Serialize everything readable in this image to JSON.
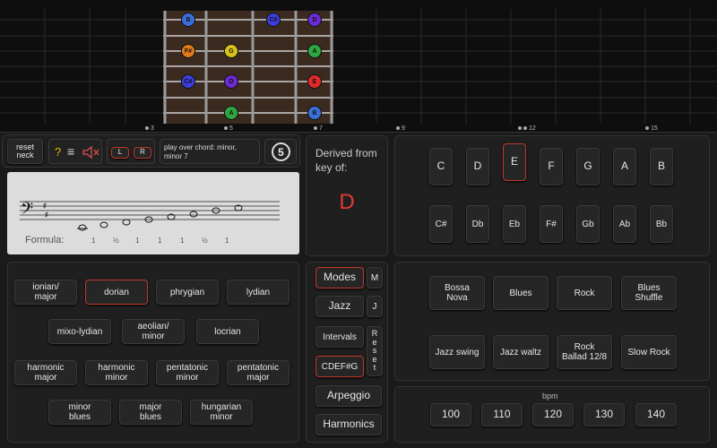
{
  "fretboard": {
    "fret_labels": [
      {
        "text": "3",
        "dots": 1
      },
      {
        "text": "5",
        "dots": 1
      },
      {
        "text": "7",
        "dots": 1
      },
      {
        "text": "9",
        "dots": 1
      },
      {
        "text": "12",
        "dots": 2
      },
      {
        "text": "15",
        "dots": 1
      }
    ],
    "notes": [
      {
        "label": "B",
        "color": "#3a6fd8"
      },
      {
        "label": "C#",
        "color": "#3d3ddb"
      },
      {
        "label": "D",
        "color": "#6a2bd0"
      },
      {
        "label": "F#",
        "color": "#e07b1a"
      },
      {
        "label": "G",
        "color": "#d8c21a"
      },
      {
        "label": "A",
        "color": "#2fa640"
      },
      {
        "label": "C#",
        "color": "#3d3ddb"
      },
      {
        "label": "D",
        "color": "#6a2bd0"
      },
      {
        "label": "E",
        "color": "#e02a2a"
      },
      {
        "label": "A",
        "color": "#2fa640"
      },
      {
        "label": "B",
        "color": "#3a6fd8"
      }
    ]
  },
  "controls": {
    "reset_neck": "reset\nneck",
    "help": "?",
    "menu": "≡",
    "mute_icon": "speaker-muted-icon",
    "left": "L",
    "right": "R",
    "chord_hint": "play over chord: minor, minor 7",
    "fifths": "5"
  },
  "staff": {
    "formula_label": "Formula:",
    "formula": [
      "1",
      "1",
      "½",
      "1",
      "1",
      "1",
      "½",
      "1"
    ]
  },
  "derived": {
    "label": "Derived from\nkey of:",
    "key": "D",
    "key_color": "#e53935"
  },
  "keys": {
    "naturals": [
      "C",
      "D",
      "E",
      "F",
      "G",
      "A",
      "B"
    ],
    "accidentals": [
      "C#",
      "Db",
      "Eb",
      "F#",
      "Gb",
      "Ab",
      "Bb"
    ],
    "selected": "E"
  },
  "scales": {
    "row1": [
      "ionian/\nmajor",
      "dorian",
      "phrygian",
      "lydian"
    ],
    "row2": [
      "mixo-lydian",
      "aeolian/\nminor",
      "locrian"
    ],
    "row3": [
      "harmonic\nmajor",
      "harmonic\nminor",
      "pentatonic\nminor",
      "pentatonic\nmajor"
    ],
    "row4": [
      "minor\nblues",
      "major\nblues",
      "hungarian\nminor"
    ],
    "selected": "dorian"
  },
  "modes": {
    "modes": "Modes",
    "m": "M",
    "jazz": "Jazz",
    "j": "J",
    "intervals": "Intervals",
    "reset": "R\ne\ns\ne\nt",
    "notes_label": "CDEF#G",
    "arpeggio": "Arpeggio",
    "harmonics": "Harmonics"
  },
  "styles": {
    "row1": [
      "Bossa\nNova",
      "Blues",
      "Rock",
      "Blues\nShuffle"
    ],
    "row2": [
      "Jazz swing",
      "Jazz waltz",
      "Rock\nBallad 12/8",
      "Slow Rock"
    ]
  },
  "tempo": {
    "label": "bpm",
    "values": [
      "100",
      "110",
      "120",
      "130",
      "140"
    ]
  },
  "accent_color": "#c0392b"
}
